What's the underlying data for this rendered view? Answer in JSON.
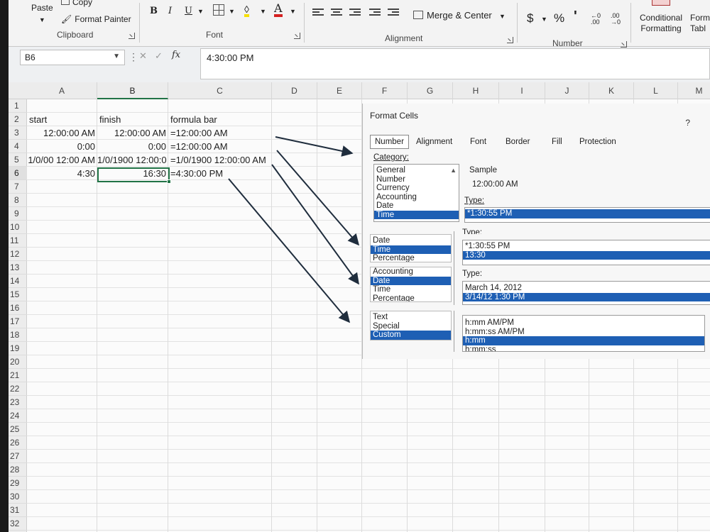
{
  "ribbon": {
    "clipboard": {
      "paste": "Paste",
      "copy": "Copy",
      "format_painter": "Format Painter",
      "label": "Clipboard"
    },
    "font": {
      "bold": "B",
      "italic": "I",
      "underline": "U",
      "font_color_glyph": "A",
      "label": "Font"
    },
    "alignment": {
      "merge_center": "Merge & Center",
      "label": "Alignment"
    },
    "number": {
      "currency": "$",
      "percent": "%",
      "comma": "'",
      "label": "Number"
    },
    "styles": {
      "conditional_formatting": "Conditional Formatting",
      "format_as_table": "Form Tabl"
    }
  },
  "formula_bar": {
    "name_box": "B6",
    "fx": "fx",
    "content": "4:30:00 PM"
  },
  "columns": [
    "A",
    "B",
    "C",
    "D",
    "E",
    "F",
    "G",
    "H",
    "I",
    "J",
    "K",
    "L",
    "M"
  ],
  "rows": [
    "1",
    "2",
    "3",
    "4",
    "5",
    "6",
    "7",
    "8",
    "9",
    "10",
    "11",
    "12",
    "13",
    "14",
    "15",
    "16",
    "17",
    "18",
    "19",
    "20",
    "21",
    "22",
    "23",
    "24",
    "25",
    "26",
    "27",
    "28",
    "29",
    "30",
    "31",
    "32"
  ],
  "cells": {
    "A2": "start",
    "B2": "finish",
    "C2": "formula bar",
    "A3": "12:00:00 AM",
    "B3": "12:00:00 AM",
    "C3": "=12:00:00 AM",
    "A4": "0:00",
    "B4": "0:00",
    "C4": "=12:00:00 AM",
    "A5": "1/0/00 12:00 AM",
    "B5": "1/0/1900  12:00:0",
    "C5": "=1/0/1900  12:00:00 AM",
    "A6": "4:30",
    "B6": "16:30",
    "C6": "=4:30:00 PM"
  },
  "dialog": {
    "title": "Format Cells",
    "help": "?",
    "tabs": [
      "Number",
      "Alignment",
      "Font",
      "Border",
      "Fill",
      "Protection"
    ],
    "active_tab": "Number",
    "category_label": "Category:",
    "categories": [
      "General",
      "Number",
      "Currency",
      "Accounting",
      "Date",
      "Time"
    ],
    "selected_category": "Time",
    "sample_label": "Sample",
    "sample_value": "12:00:00 AM",
    "type_label": "Type:",
    "type_items": [
      "*1:30:55 PM",
      "13:30"
    ],
    "snippet1": {
      "categories": [
        "Date",
        "Time",
        "Percentage"
      ],
      "selected": "Time",
      "type_label": "Type:",
      "types": [
        "*1:30:55 PM",
        "13:30"
      ],
      "selected_type": "13:30"
    },
    "snippet2": {
      "categories": [
        "Accounting",
        "Date",
        "Time",
        "Percentage"
      ],
      "selected": "Date",
      "type_label": "Type:",
      "types": [
        "March 14, 2012",
        "3/14/12 1:30 PM"
      ],
      "selected_type": "3/14/12 1:30 PM"
    },
    "snippet3": {
      "categories": [
        "Text",
        "Special",
        "Custom"
      ],
      "selected": "Custom",
      "types": [
        "h:mm AM/PM",
        "h:mm:ss AM/PM",
        "h:mm",
        "h:mm:ss"
      ],
      "selected_type": "h:mm"
    }
  }
}
